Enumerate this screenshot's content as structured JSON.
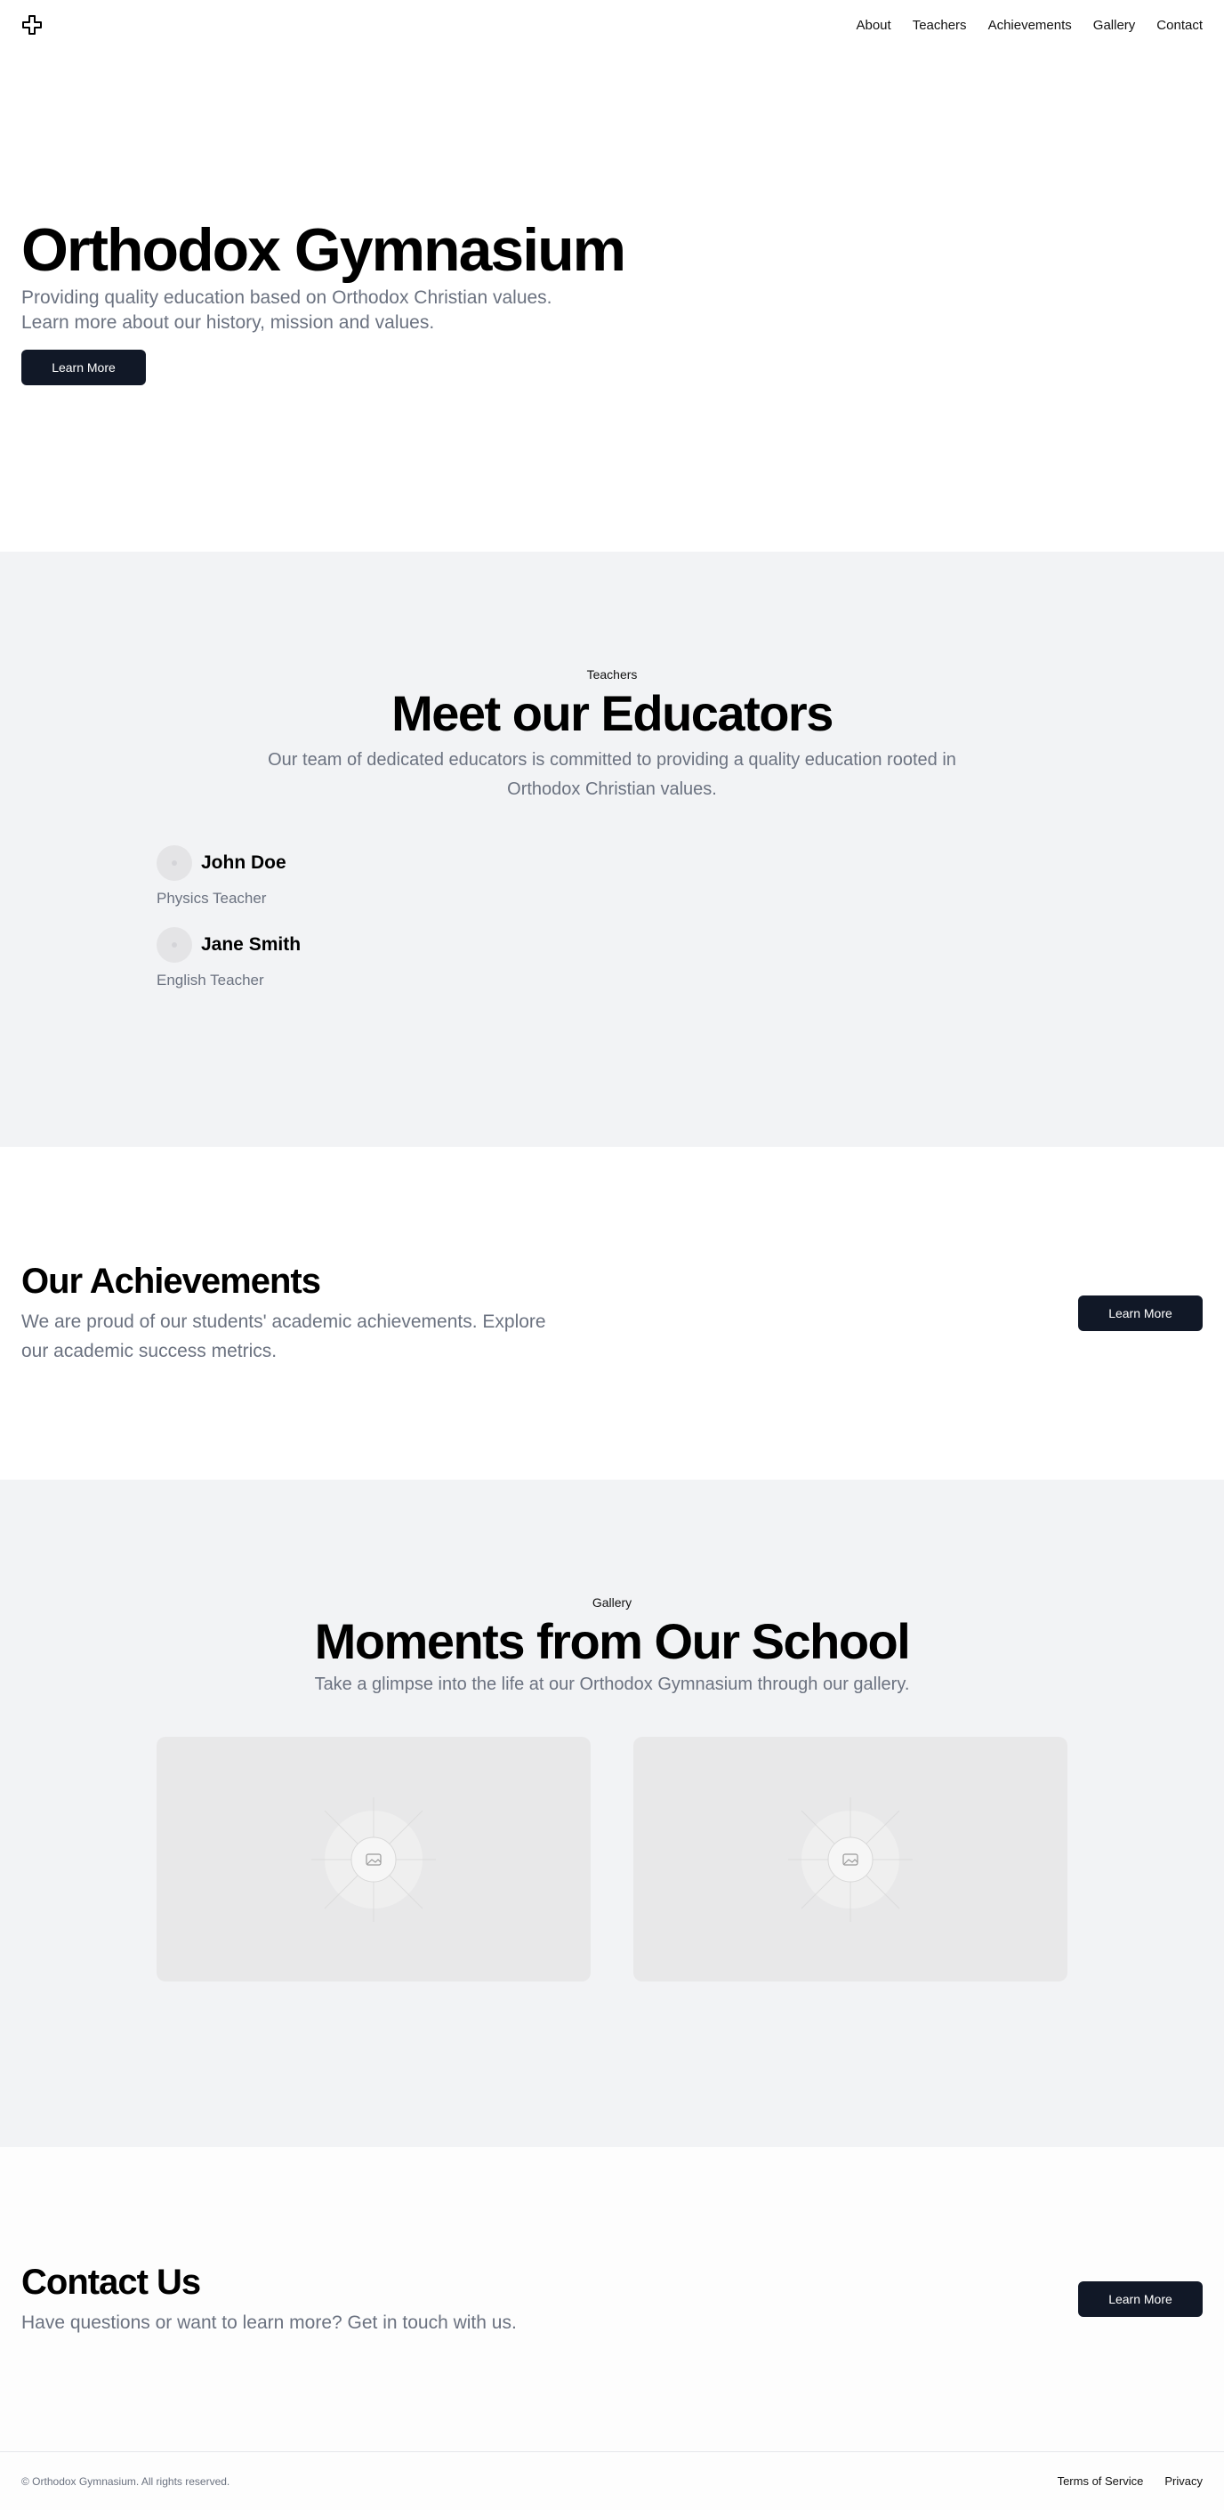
{
  "brand": {
    "logo_icon": "cross-icon"
  },
  "nav": {
    "items": [
      "About",
      "Teachers",
      "Achievements",
      "Gallery",
      "Contact"
    ]
  },
  "hero": {
    "title": "Orthodox Gymnasium",
    "subtitle": "Providing quality education based on Orthodox Christian values. Learn more about our history, mission and values.",
    "button": "Learn More"
  },
  "teachers": {
    "eyebrow": "Teachers",
    "title": "Meet our Educators",
    "subtitle": "Our team of dedicated educators is committed to providing a quality education rooted in Orthodox Christian values.",
    "items": [
      {
        "name": "John Doe",
        "role": "Physics Teacher"
      },
      {
        "name": "Jane Smith",
        "role": "English Teacher"
      }
    ]
  },
  "achievements": {
    "title": "Our Achievements",
    "subtitle": "We are proud of our students' academic achievements. Explore our academic success metrics.",
    "button": "Learn More"
  },
  "gallery": {
    "eyebrow": "Gallery",
    "title": "Moments from Our School",
    "subtitle": "Take a glimpse into the life at our Orthodox Gymnasium through our gallery.",
    "image_icon": "image-placeholder-icon"
  },
  "contact": {
    "title": "Contact Us",
    "subtitle": "Have questions or want to learn more? Get in touch with us.",
    "button": "Learn More"
  },
  "footer": {
    "copyright": "© Orthodox Gymnasium. All rights reserved.",
    "links": [
      "Terms of Service",
      "Privacy"
    ]
  },
  "colors": {
    "button_bg": "#111827",
    "section_alt_bg": "#f2f3f5",
    "muted_text": "#6b7280"
  }
}
